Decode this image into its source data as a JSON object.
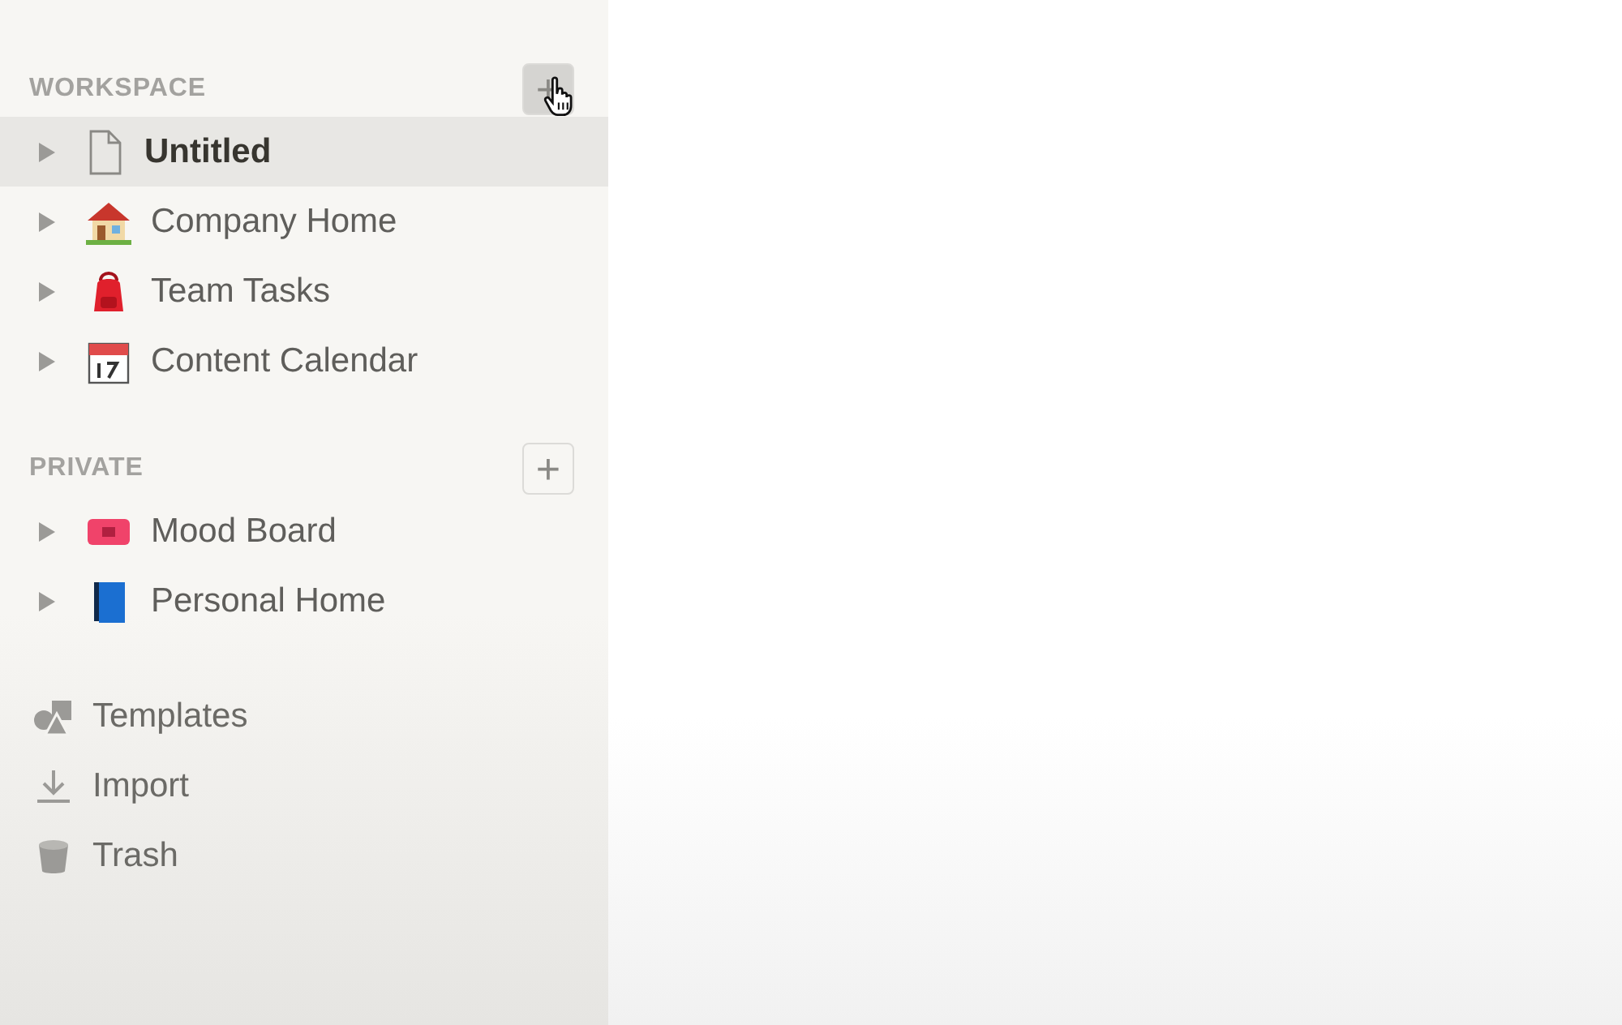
{
  "sidebar": {
    "sections": [
      {
        "title": "WORKSPACE",
        "add_button": {
          "label": "+",
          "hovered": true
        },
        "pages": [
          {
            "title": "Untitled",
            "kind": "page",
            "selected": true
          },
          {
            "title": "Company Home",
            "kind": "house",
            "selected": false
          },
          {
            "title": "Team Tasks",
            "kind": "backpack",
            "selected": false
          },
          {
            "title": "Content Calendar",
            "kind": "calendar",
            "selected": false
          }
        ]
      },
      {
        "title": "PRIVATE",
        "add_button": {
          "label": "+",
          "hovered": false
        },
        "pages": [
          {
            "title": "Mood Board",
            "kind": "ticket",
            "selected": false
          },
          {
            "title": "Personal Home",
            "kind": "book",
            "selected": false
          }
        ]
      }
    ],
    "tools": [
      {
        "label": "Templates",
        "kind": "templates"
      },
      {
        "label": "Import",
        "kind": "import"
      },
      {
        "label": "Trash",
        "kind": "trash"
      }
    ]
  }
}
